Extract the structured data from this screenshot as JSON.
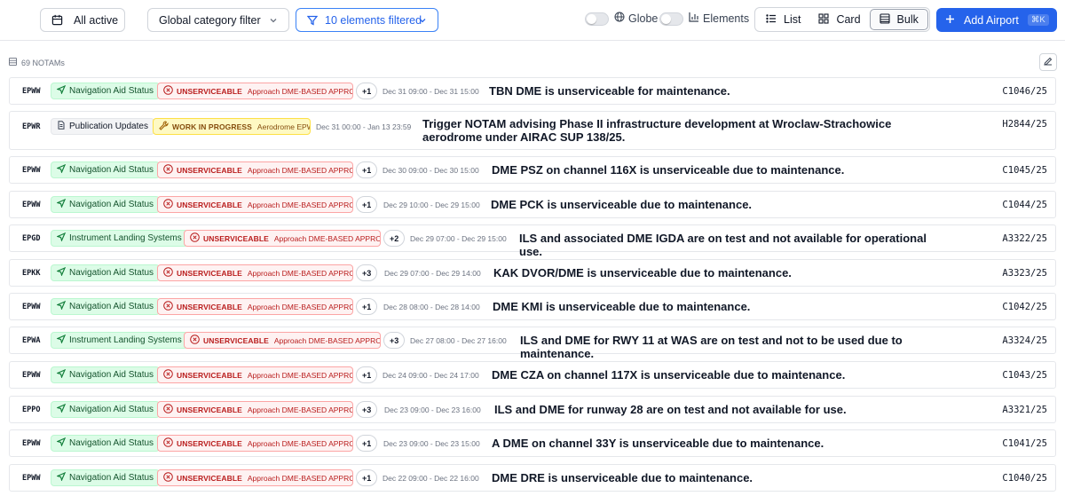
{
  "toolbar": {
    "active_label": "All active",
    "category_label": "Global category filter",
    "filter_label": "10 elements filtered",
    "globe_label": "Globe",
    "elements_label": "Elements",
    "view_list": "List",
    "view_card": "Card",
    "view_bulk": "Bulk",
    "view_selected": "Bulk",
    "add_label": "Add Airport",
    "add_shortcut": "⌘K"
  },
  "summary": {
    "count_label": "69 NOTAMs"
  },
  "colors": {
    "accent": "#2563eb",
    "category_green": "#dcfce7",
    "status_red": "#fef2f2",
    "status_yellow": "#fef9c3"
  },
  "notams": [
    {
      "icao": "EPWW",
      "category": "Navigation Aid Status",
      "category_icon": "navigation-icon",
      "status": "UNSERVICEABLE",
      "status_detail": "Approach DME-BASED APPRO...",
      "extra": "+1",
      "dates": "Dec 31 09:00 - Dec 31 15:00",
      "text": "TBN DME is unserviceable for maintenance.",
      "id": "C1046/25"
    },
    {
      "icao": "EPWR",
      "category": "Publication Updates",
      "category_icon": "document-icon",
      "status": "WORK IN PROGRESS",
      "status_detail": "Aerodrome EPWR",
      "extra": "",
      "dates": "Dec 31 00:00 - Jan 13 23:59",
      "text": "Trigger NOTAM advising Phase II infrastructure development at Wroclaw-Strachowice aerodrome under AIRAC SUP 138/25.",
      "id": "H2844/25"
    },
    {
      "icao": "EPWW",
      "category": "Navigation Aid Status",
      "category_icon": "navigation-icon",
      "status": "UNSERVICEABLE",
      "status_detail": "Approach DME-BASED APPRO...",
      "extra": "+1",
      "dates": "Dec 30 09:00 - Dec 30 15:00",
      "text": "DME PSZ on channel 116X is unserviceable due to maintenance.",
      "id": "C1045/25"
    },
    {
      "icao": "EPWW",
      "category": "Navigation Aid Status",
      "category_icon": "navigation-icon",
      "status": "UNSERVICEABLE",
      "status_detail": "Approach DME-BASED APPRO...",
      "extra": "+1",
      "dates": "Dec 29 10:00 - Dec 29 15:00",
      "text": "DME PCK is unserviceable due to maintenance.",
      "id": "C1044/25"
    },
    {
      "icao": "EPGD",
      "category": "Instrument Landing Systems",
      "category_icon": "navigation-icon",
      "status": "UNSERVICEABLE",
      "status_detail": "Approach DME-BASED APPRO...",
      "extra": "+2",
      "dates": "Dec 29 07:00 - Dec 29 15:00",
      "text": "ILS and associated DME IGDA are on test and not available for operational use.",
      "id": "A3322/25"
    },
    {
      "icao": "EPKK",
      "category": "Navigation Aid Status",
      "category_icon": "navigation-icon",
      "status": "UNSERVICEABLE",
      "status_detail": "Approach DME-BASED APPRO...",
      "extra": "+3",
      "dates": "Dec 29 07:00 - Dec 29 14:00",
      "text": "KAK DVOR/DME is unserviceable due to maintenance.",
      "id": "A3323/25"
    },
    {
      "icao": "EPWW",
      "category": "Navigation Aid Status",
      "category_icon": "navigation-icon",
      "status": "UNSERVICEABLE",
      "status_detail": "Approach DME-BASED APPRO...",
      "extra": "+1",
      "dates": "Dec 28 08:00 - Dec 28 14:00",
      "text": "DME KMI is unserviceable due to maintenance.",
      "id": "C1042/25"
    },
    {
      "icao": "EPWA",
      "category": "Instrument Landing Systems",
      "category_icon": "navigation-icon",
      "status": "UNSERVICEABLE",
      "status_detail": "Approach DME-BASED APPRO...",
      "extra": "+3",
      "dates": "Dec 27 08:00 - Dec 27 16:00",
      "text": "ILS and DME for RWY 11 at WAS are on test and not to be used due to maintenance.",
      "id": "A3324/25"
    },
    {
      "icao": "EPWW",
      "category": "Navigation Aid Status",
      "category_icon": "navigation-icon",
      "status": "UNSERVICEABLE",
      "status_detail": "Approach DME-BASED APPRO...",
      "extra": "+1",
      "dates": "Dec 24 09:00 - Dec 24 17:00",
      "text": "DME CZA on channel 117X is unserviceable due to maintenance.",
      "id": "C1043/25"
    },
    {
      "icao": "EPPO",
      "category": "Navigation Aid Status",
      "category_icon": "navigation-icon",
      "status": "UNSERVICEABLE",
      "status_detail": "Approach DME-BASED APPRO...",
      "extra": "+3",
      "dates": "Dec 23 09:00 - Dec 23 16:00",
      "text": "ILS and DME for runway 28 are on test and not available for use.",
      "id": "A3321/25"
    },
    {
      "icao": "EPWW",
      "category": "Navigation Aid Status",
      "category_icon": "navigation-icon",
      "status": "UNSERVICEABLE",
      "status_detail": "Approach DME-BASED APPRO...",
      "extra": "+1",
      "dates": "Dec 23 09:00 - Dec 23 15:00",
      "text": "A DME on channel 33Y is unserviceable due to maintenance.",
      "id": "C1041/25"
    },
    {
      "icao": "EPWW",
      "category": "Navigation Aid Status",
      "category_icon": "navigation-icon",
      "status": "UNSERVICEABLE",
      "status_detail": "Approach DME-BASED APPRO...",
      "extra": "+1",
      "dates": "Dec 22 09:00 - Dec 22 16:00",
      "text": "DME DRE is unserviceable due to maintenance.",
      "id": "C1040/25"
    }
  ]
}
